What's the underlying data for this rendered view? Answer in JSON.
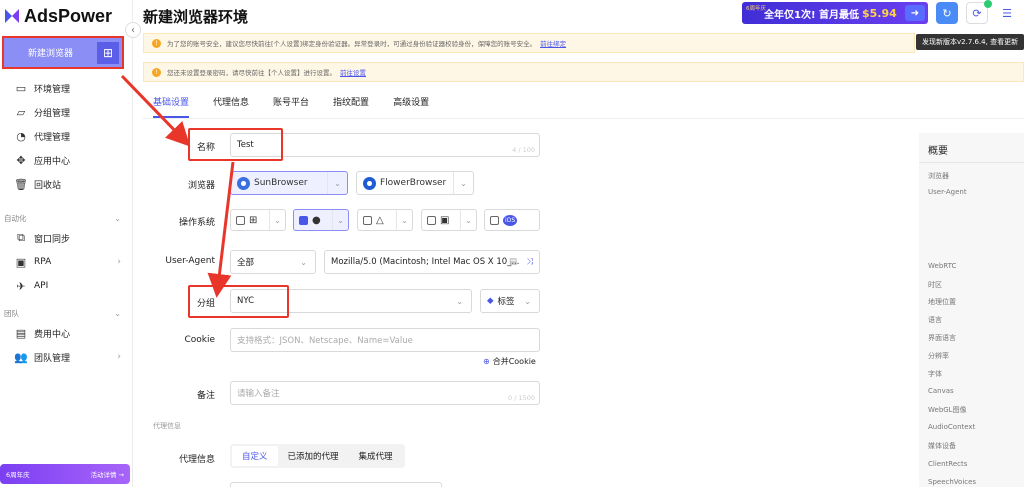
{
  "app": {
    "logo_text": "AdsPower"
  },
  "sidebar": {
    "new_button": "新建浏览器",
    "items_top": [
      {
        "label": "环境管理",
        "icon": "window-icon"
      },
      {
        "label": "分组管理",
        "icon": "folder-icon"
      },
      {
        "label": "代理管理",
        "icon": "proxy-icon"
      },
      {
        "label": "应用中心",
        "icon": "puzzle-icon"
      },
      {
        "label": "回收站",
        "icon": "trash-icon"
      }
    ],
    "section_automation": "自动化",
    "items_auto": [
      {
        "label": "窗口同步",
        "icon": "sync-icon"
      },
      {
        "label": "RPA",
        "icon": "rpa-icon"
      },
      {
        "label": "API",
        "icon": "api-icon"
      }
    ],
    "section_team": "团队",
    "items_team": [
      {
        "label": "费用中心",
        "icon": "billing-icon"
      },
      {
        "label": "团队管理",
        "icon": "team-icon"
      }
    ],
    "promo_left": "6周年庆",
    "promo_right": "活动详情 →"
  },
  "header": {
    "title": "新建浏览器环境",
    "ad_small": "6周年庆",
    "ad_main": "全年仅1次! 首月最低",
    "ad_price": "$5.94",
    "tooltip": "发现新版本v2.7.6.4, 查看更新"
  },
  "alerts": [
    {
      "text": "为了您的账号安全，建议您尽快前往[个人设置]绑定身份验证器。异常登录时，可通过身份验证器校验身份，保障您的账号安全。",
      "link": "前往绑定"
    },
    {
      "text": "您还未设置登录密码，请尽快前往【个人设置】进行设置。",
      "link": "前往设置"
    }
  ],
  "tabs": [
    "基础设置",
    "代理信息",
    "账号平台",
    "指纹配置",
    "高级设置"
  ],
  "form": {
    "name_label": "名称",
    "name_value": "Test",
    "name_counter": "4 / 100",
    "browser_label": "浏览器",
    "browser_options": [
      "SunBrowser",
      "FlowerBrowser"
    ],
    "os_label": "操作系统",
    "ua_label": "User-Agent",
    "ua_filter": "全部",
    "ua_value": "Mozilla/5.0 (Macintosh; Intel Mac OS X 10_...",
    "group_label": "分组",
    "group_value": "NYC",
    "tag_label": "标签",
    "cookie_label": "Cookie",
    "cookie_placeholder": "支持格式：JSON、Netscape、Name=Value",
    "merge_cookie": "合并Cookie",
    "note_label": "备注",
    "note_placeholder": "请输入备注",
    "note_counter": "0 / 1500",
    "proxy_section": "代理信息",
    "proxy_label": "代理信息",
    "proxy_options": [
      "自定义",
      "已添加的代理",
      "集成代理"
    ]
  },
  "overview": {
    "title": "概要",
    "items": [
      "浏览器",
      "User-Agent",
      "WebRTC",
      "时区",
      "地理位置",
      "语言",
      "界面语言",
      "分辨率",
      "字体",
      "Canvas",
      "WebGL图像",
      "AudioContext",
      "媒体设备",
      "ClientRects",
      "SpeechVoices"
    ]
  },
  "colors": {
    "accent": "#4a56e8",
    "highlight": "#e8372a",
    "button": "#8b8ef5"
  }
}
